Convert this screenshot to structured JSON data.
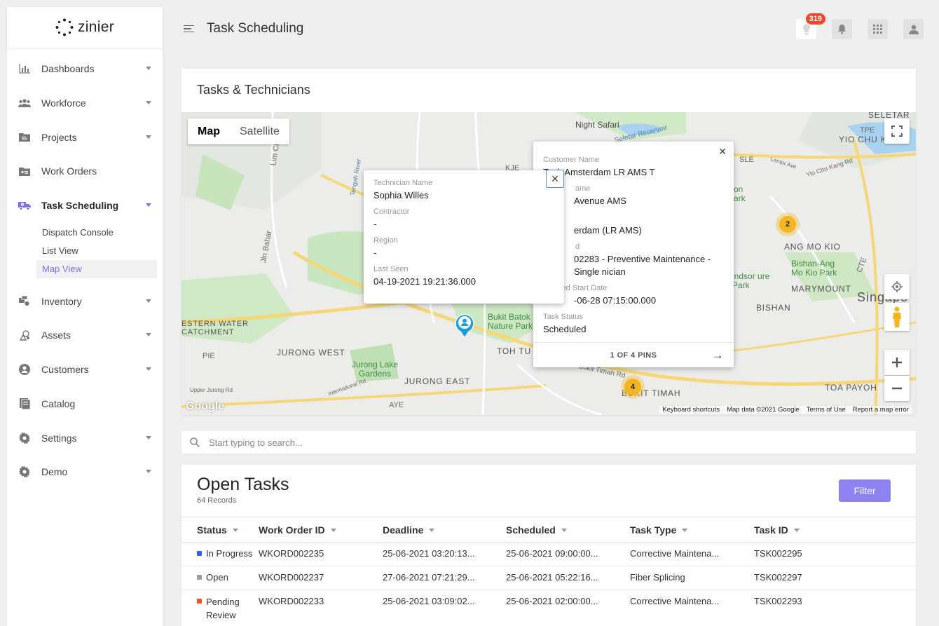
{
  "brand": {
    "name": "zinier"
  },
  "sidebar": {
    "items": [
      {
        "label": "Dashboards",
        "icon": "bar-chart-icon",
        "expandable": true
      },
      {
        "label": "Workforce",
        "icon": "people-icon",
        "expandable": true
      },
      {
        "label": "Projects",
        "icon": "folder-icon",
        "expandable": true
      },
      {
        "label": "Work Orders",
        "icon": "id-card-icon",
        "expandable": false
      },
      {
        "label": "Task Scheduling",
        "icon": "truck-icon",
        "expandable": true,
        "active": true
      },
      {
        "label": "Inventory",
        "icon": "inventory-icon",
        "expandable": true
      },
      {
        "label": "Assets",
        "icon": "assets-icon",
        "expandable": true
      },
      {
        "label": "Customers",
        "icon": "user-circle-icon",
        "expandable": true
      },
      {
        "label": "Catalog",
        "icon": "catalog-icon",
        "expandable": false
      },
      {
        "label": "Settings",
        "icon": "gear-icon",
        "expandable": true
      },
      {
        "label": "Demo",
        "icon": "gear-icon",
        "expandable": true
      }
    ],
    "sub_items": [
      {
        "label": "Dispatch Console"
      },
      {
        "label": "List View"
      },
      {
        "label": "Map View",
        "active": true
      }
    ]
  },
  "header": {
    "title": "Task Scheduling",
    "notification_count": "319"
  },
  "map_card": {
    "title": "Tasks & Technicians",
    "map_type": {
      "map": "Map",
      "satellite": "Satellite"
    },
    "labels": {
      "night_safari": "Night Safari",
      "seletar_reservoir": "Seletar Reservoir",
      "seletar": "SELETAR",
      "yio_chu_kang": "YIO CHU KANG",
      "tpe": "TPE",
      "ang_mo_kio": "ANG MO KIO",
      "bishan_park": "Bishan-Ang Mo Kio Park",
      "marymount": "MARYMOUNT",
      "bishan": "BISHAN",
      "singapore": "Singapo",
      "toa_payoh": "TOA PAYOH",
      "western_water": "ESTERN WATER CATCHMENT",
      "jurong_west": "JURONG WEST",
      "jurong_east": "JURONG EAST",
      "jurong_lake": "Jurong Lake Gardens",
      "bukit_batok": "Bukit Batok Nature Park",
      "bukit_timah": "BUKIT TIMAH",
      "toh_tuck": "TOH TU",
      "pie": "PIE",
      "kje": "KJE",
      "aye": "AYE",
      "sle": "SLE",
      "cte": "CTE",
      "jin_bahar": "Jln Bahar",
      "lim_chu_kang": "Lim Chu",
      "tengah_river": "Tengah River",
      "upper_jurong": "Upper Jurong Rd",
      "international_rd": "International Rd",
      "bukit_timah_rd": "Bukit Timah Rd",
      "yio_chu_kang_rd": "Yio Chu Kang Rd",
      "lentor": "Lentor Ave",
      "park_partial": "on ark",
      "windsor": "indsor ure Park"
    },
    "clusters": [
      "2",
      "4"
    ],
    "footer": {
      "shortcuts": "Keyboard shortcuts",
      "map_data": "Map data ©2021 Google",
      "terms": "Terms of Use",
      "report": "Report a map error"
    },
    "google_logo": "Google",
    "technician_popup": {
      "fields": [
        {
          "label": "Technician Name",
          "value": "Sophia Willes"
        },
        {
          "label": "Contractor",
          "value": "-"
        },
        {
          "label": "Region",
          "value": "-"
        },
        {
          "label": "Last Seen",
          "value": "04-19-2021 19:21:36.000"
        }
      ]
    },
    "task_popup": {
      "fields": [
        {
          "label": "Customer Name",
          "value": "Tech Amsterdam LR AMS T"
        },
        {
          "label": "ame",
          "value": "Avenue AMS"
        },
        {
          "label": "",
          "value": "erdam (LR AMS)"
        },
        {
          "label": "d",
          "value": "02283 - Preventive Maintenance - Single nician"
        },
        {
          "label": "uled Start Date",
          "value": "-06-28 07:15:00.000"
        },
        {
          "label": "Task Status",
          "value": "Scheduled"
        }
      ],
      "pager": "1 OF 4 PINS"
    }
  },
  "search": {
    "placeholder": "Start typing to search..."
  },
  "tasks": {
    "title": "Open Tasks",
    "records": "64 Records",
    "filter_label": "Filter",
    "columns": [
      "Status",
      "Work Order ID",
      "Deadline",
      "Scheduled",
      "Task Type",
      "Task ID"
    ],
    "rows": [
      {
        "status": "In Progress",
        "status_color": "#3a5df0",
        "work_order": "WKORD002235",
        "deadline": "25-06-2021 03:20:13...",
        "scheduled": "25-06-2021 09:00:00...",
        "task_type": "Corrective Maintena...",
        "task_id": "TSK002295"
      },
      {
        "status": "Open",
        "status_color": "#9e9e9e",
        "work_order": "WKORD002237",
        "deadline": "27-06-2021 07:21:29...",
        "scheduled": "25-06-2021 05:22:16...",
        "task_type": "Fiber Splicing",
        "task_id": "TSK002297"
      },
      {
        "status": "Pending Review",
        "status_color": "#f0532b",
        "work_order": "WKORD002233",
        "deadline": "25-06-2021 03:09:02...",
        "scheduled": "25-06-2021 02:00:00...",
        "task_type": "Corrective Maintena...",
        "task_id": "TSK002293"
      }
    ]
  },
  "colors": {
    "accent": "#7b72e9",
    "filter": "#8c83f0",
    "badge": "#f0442b",
    "cluster": "#f3b61f",
    "pin": "#1a9fd9"
  }
}
